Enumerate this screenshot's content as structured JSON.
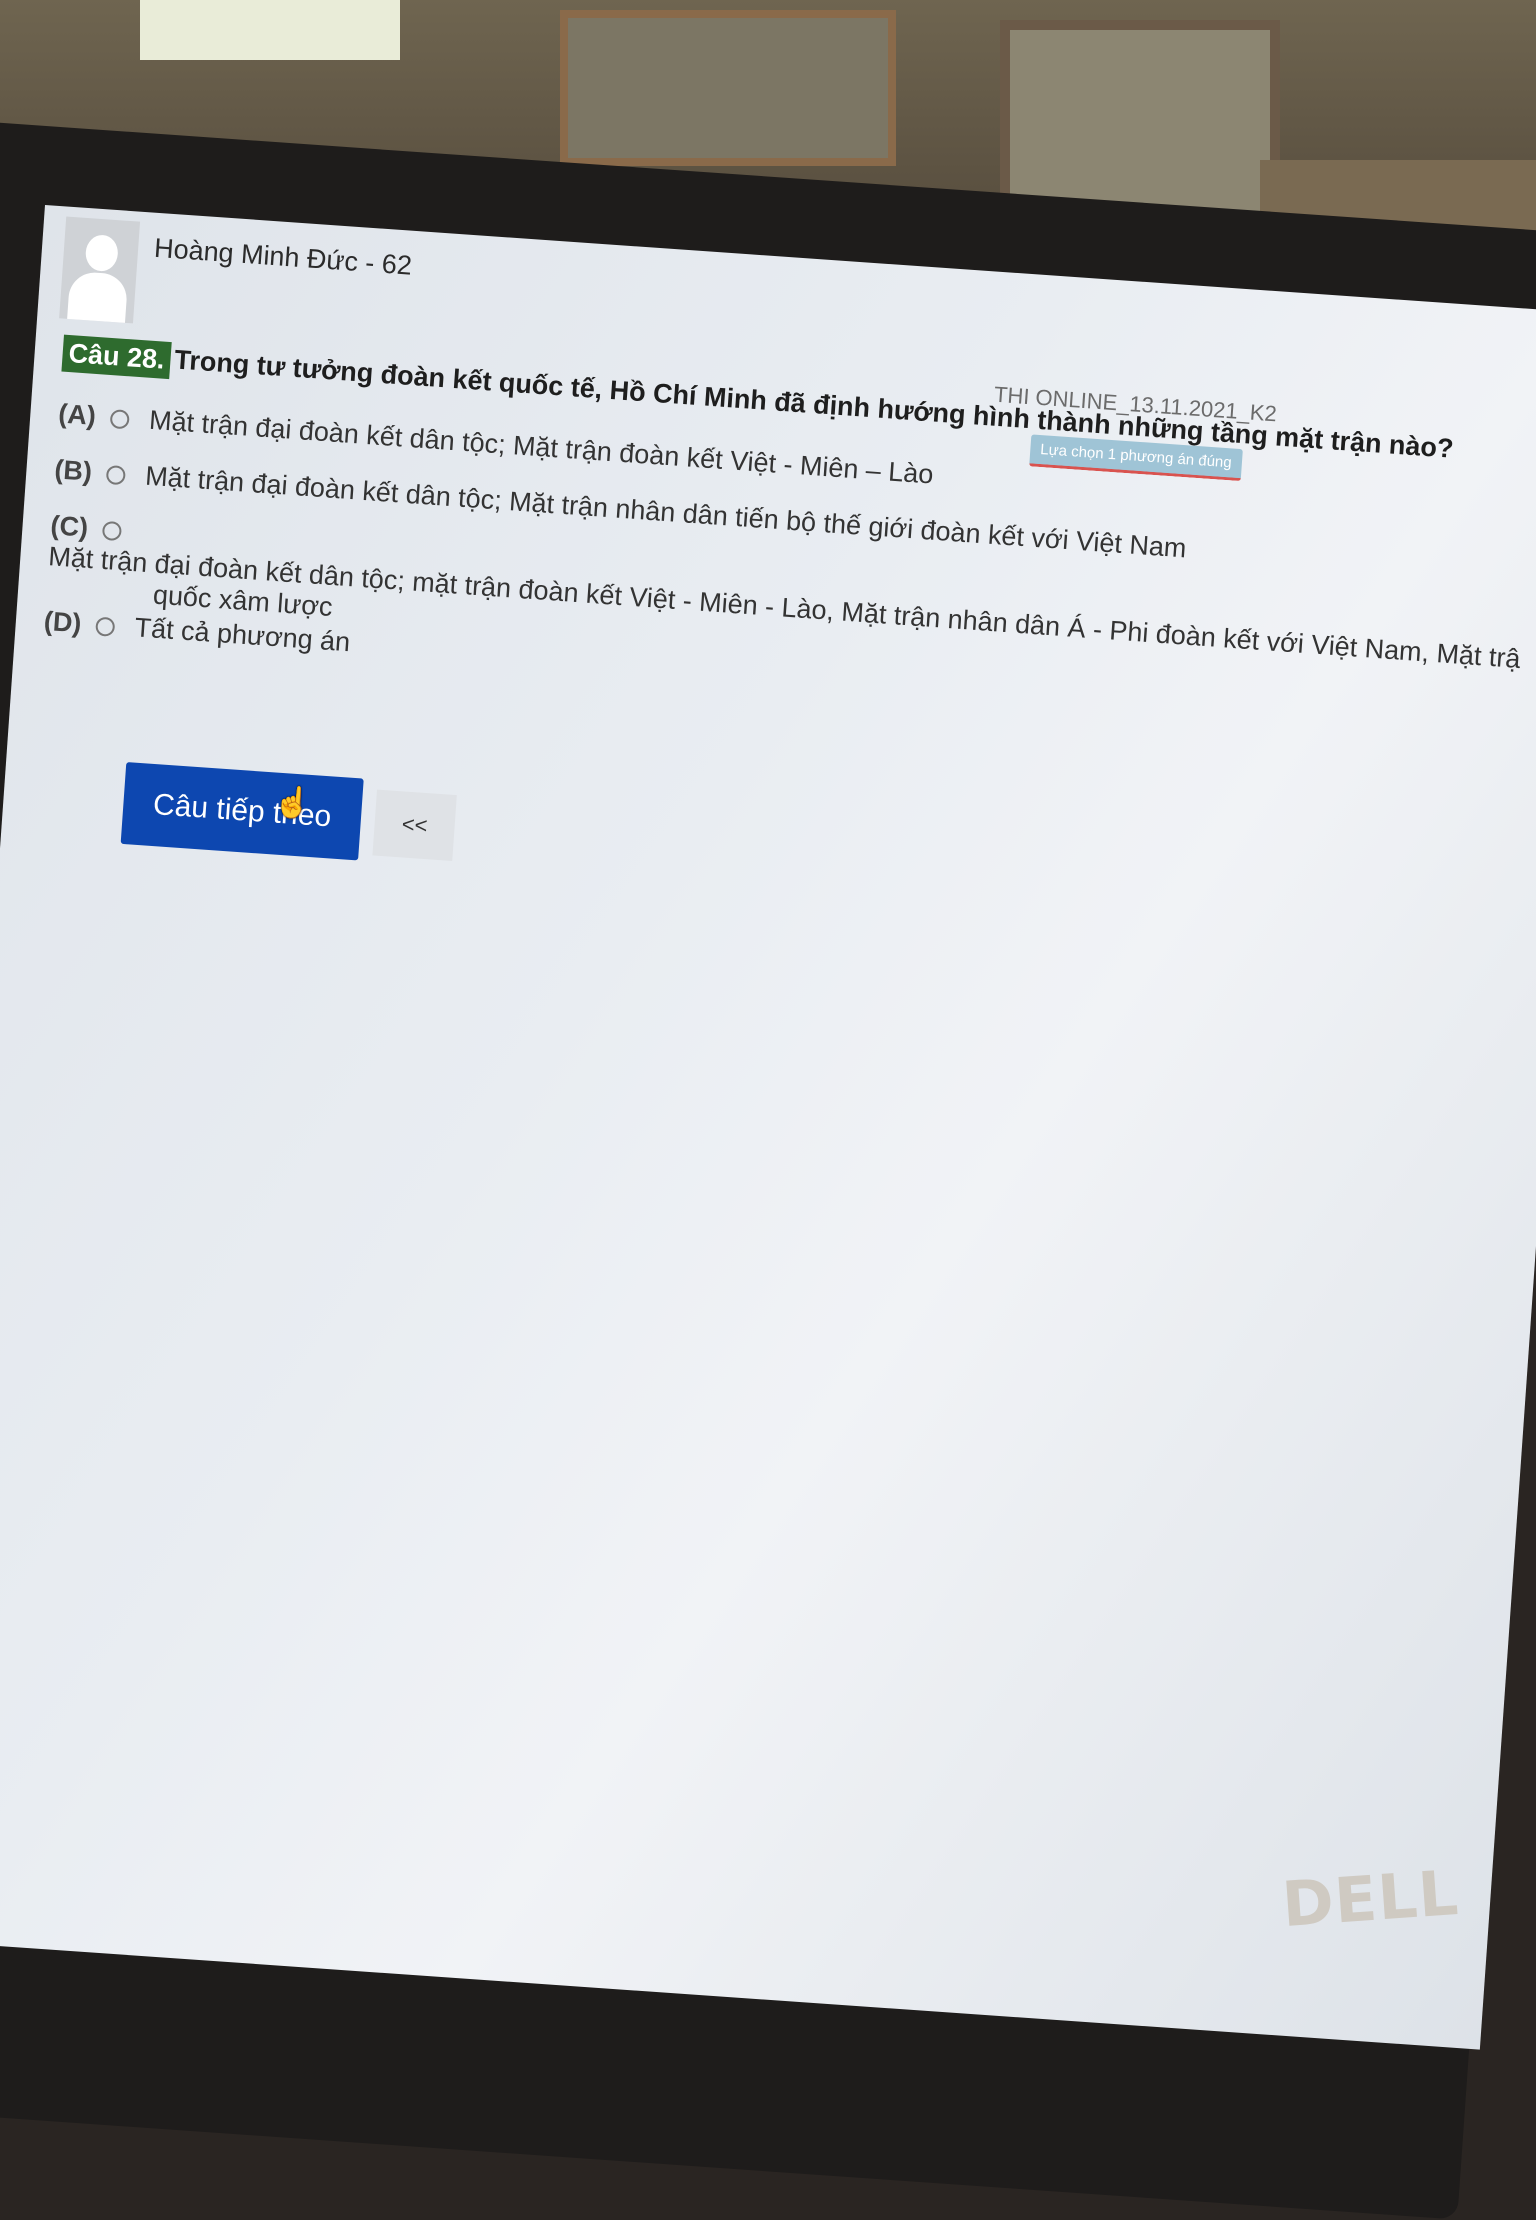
{
  "user": {
    "name": "Hoàng Minh Đức - 62"
  },
  "exam": {
    "title": "THI ONLINE_13.11.2021_K2",
    "hint": "Lựa chọn 1 phương án đúng"
  },
  "question": {
    "number": "Câu 28.",
    "text": "Trong tư tưởng đoàn kết quốc tế, Hồ Chí Minh đã định hướng hình thành những tầng mặt trận nào?",
    "options": [
      {
        "key": "(A)",
        "text": "Mặt trận đại đoàn kết dân tộc; Mặt trận đoàn kết Việt - Miên – Lào"
      },
      {
        "key": "(B)",
        "text": "Mặt trận đại đoàn kết dân tộc; Mặt trận nhân dân tiến bộ thế giới đoàn kết với Việt Nam"
      },
      {
        "key": "(C)",
        "text": "Mặt trận đại đoàn kết dân tộc; mặt trận đoàn kết Việt - Miên - Lào, Mặt trận nhân dân Á - Phi đoàn kết với Việt Nam, Mặt trậ",
        "text_cont": "quốc xâm lược"
      },
      {
        "key": "(D)",
        "text": "Tất cả phương án"
      }
    ]
  },
  "buttons": {
    "next": "Câu tiếp theo",
    "prev": "<<"
  },
  "brand": "DELL",
  "colors": {
    "primary_button": "#0d47b0",
    "question_badge": "#2e6b2e",
    "hint_badge": "#9fc4d6"
  },
  "icons": {
    "cursor": "hand-pointer-icon",
    "radio": "radio-icon",
    "avatar": "user-avatar-icon"
  }
}
